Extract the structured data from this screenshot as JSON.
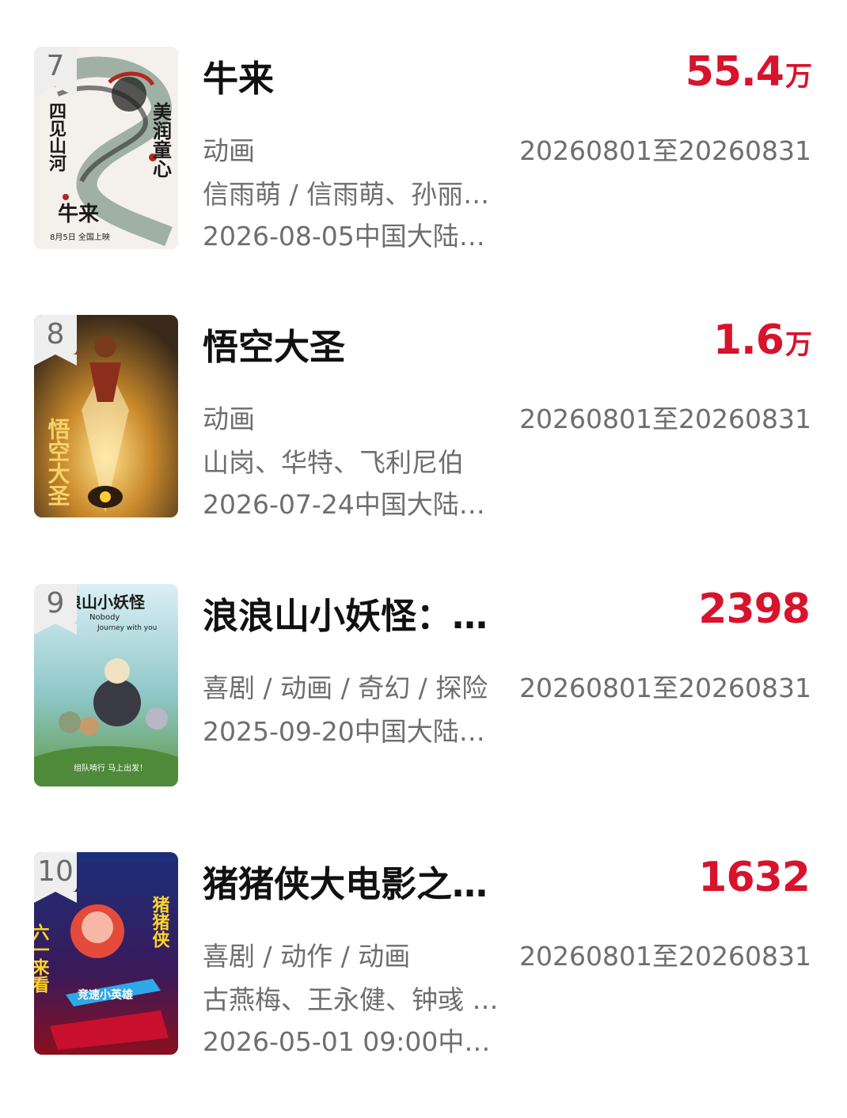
{
  "movies": [
    {
      "rank": "7",
      "title": "牛来",
      "amount": "55.4",
      "unit": "万",
      "genre": "动画",
      "period": "20260801至20260831",
      "cast": "信雨萌 / 信雨萌、孙丽…",
      "release": "2026-08-05中国大陆上…",
      "poster_text": [
        "美润童心",
        "四见山河",
        "牛来",
        "8月5日 全国上映"
      ]
    },
    {
      "rank": "8",
      "title": "悟空大圣",
      "amount": "1.6",
      "unit": "万",
      "genre": "动画",
      "period": "20260801至20260831",
      "cast": "山岗、华特、飞利尼伯",
      "release": "2026-07-24中国大陆上…",
      "poster_text": [
        "悟空大圣"
      ]
    },
    {
      "rank": "9",
      "title": "浪浪山小妖怪：…",
      "amount": "2398",
      "unit": "",
      "genre": "喜剧 / 动画 / 奇幻 / 探险",
      "period": "20260801至20260831",
      "cast": "",
      "release": "2025-09-20中国大陆上…",
      "poster_text": [
        "浪浪山小妖怪",
        "Nobody",
        "Journey with you",
        "组队啃行 马上出发！"
      ]
    },
    {
      "rank": "10",
      "title": "猪猪侠大电影之…",
      "amount": "1632",
      "unit": "",
      "genre": "喜剧 / 动作 / 动画",
      "period": "20260801至20260831",
      "cast": "古燕梅、王永健、钟彧 /…",
      "release": "2026-05-01 09:00中国…",
      "poster_text": [
        "六一来看",
        "猪猪侠",
        "竞速小英雄"
      ]
    }
  ],
  "colors": {
    "amount": "#d8132c",
    "meta": "#6e6e6e",
    "rank_badge": "#eeeeee"
  }
}
